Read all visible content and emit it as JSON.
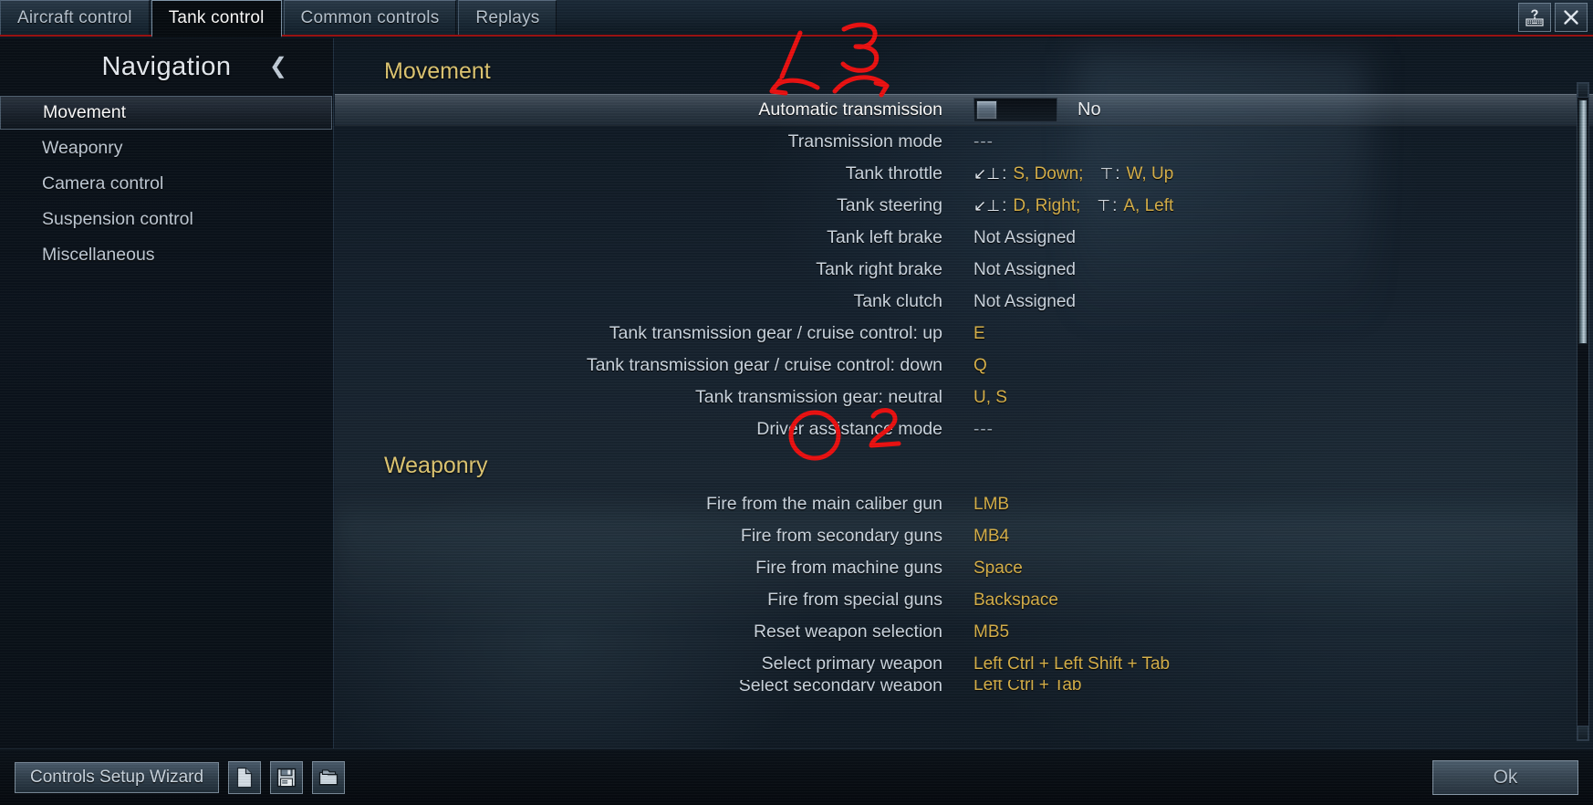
{
  "window": {
    "tabs": [
      {
        "label": "Aircraft control",
        "active": false
      },
      {
        "label": "Tank control",
        "active": true
      },
      {
        "label": "Common controls",
        "active": false
      },
      {
        "label": "Replays",
        "active": false
      }
    ],
    "help_icon": "keyboard-help-icon",
    "close_icon": "close-icon"
  },
  "sidebar": {
    "title": "Navigation",
    "collapse_icon": "chevron-left-icon",
    "items": [
      {
        "label": "Movement",
        "selected": true
      },
      {
        "label": "Weaponry",
        "selected": false
      },
      {
        "label": "Camera control",
        "selected": false
      },
      {
        "label": "Suspension control",
        "selected": false
      },
      {
        "label": "Miscellaneous",
        "selected": false
      }
    ]
  },
  "content": {
    "sections": [
      {
        "title": "Movement",
        "rows": [
          {
            "label": "Automatic transmission",
            "type": "toggle",
            "toggle_state": "off",
            "value": "No",
            "highlighted": true
          },
          {
            "label": "Transmission mode",
            "type": "text",
            "value": "---",
            "style": "dim"
          },
          {
            "label": "Tank throttle",
            "type": "axis",
            "axis_down_glyph": "axis-down-icon",
            "axis_down_value": "S, Down;",
            "axis_up_glyph": "axis-up-icon",
            "axis_up_value": "W, Up"
          },
          {
            "label": "Tank steering",
            "type": "axis",
            "axis_down_glyph": "axis-down-icon",
            "axis_down_value": "D, Right;",
            "axis_up_glyph": "axis-up-icon",
            "axis_up_value": "A, Left"
          },
          {
            "label": "Tank left brake",
            "type": "text",
            "value": "Not Assigned",
            "style": "plain"
          },
          {
            "label": "Tank right brake",
            "type": "text",
            "value": "Not Assigned",
            "style": "plain"
          },
          {
            "label": "Tank clutch",
            "type": "text",
            "value": "Not Assigned",
            "style": "plain"
          },
          {
            "label": "Tank transmission gear / cruise control: up",
            "type": "text",
            "value": "E"
          },
          {
            "label": "Tank transmission gear / cruise control: down",
            "type": "text",
            "value": "Q"
          },
          {
            "label": "Tank transmission gear: neutral",
            "type": "text",
            "value": "U, S"
          },
          {
            "label": "Driver assistance mode",
            "type": "text",
            "value": "---",
            "style": "dim"
          }
        ]
      },
      {
        "title": "Weaponry",
        "rows": [
          {
            "label": "Fire from the main caliber gun",
            "type": "text",
            "value": "LMB"
          },
          {
            "label": "Fire from secondary guns",
            "type": "text",
            "value": "MB4"
          },
          {
            "label": "Fire from machine guns",
            "type": "text",
            "value": "Space"
          },
          {
            "label": "Fire from special guns",
            "type": "text",
            "value": "Backspace"
          },
          {
            "label": "Reset weapon selection",
            "type": "text",
            "value": "MB5"
          },
          {
            "label": "Select primary weapon",
            "type": "text",
            "value": "Left Ctrl + Left Shift + Tab"
          },
          {
            "label": "Select secondary weapon",
            "type": "text",
            "value": "Left Ctrl + Tab",
            "clipped": true
          }
        ]
      }
    ]
  },
  "footer": {
    "wizard_label": "Controls Setup Wizard",
    "new_icon": "new-document-icon",
    "save_icon": "save-floppy-icon",
    "open_icon": "open-folder-icon",
    "ok_label": "Ok"
  },
  "annotations": [
    {
      "name": "annotation-1",
      "text": "1"
    },
    {
      "name": "annotation-2",
      "text": "2"
    },
    {
      "name": "annotation-3",
      "text": "3"
    }
  ],
  "colors": {
    "accent_gold": "#d9b24a",
    "section_heading": "#e0c873",
    "annotation_red": "#ee1111",
    "tab_underline": "#9c1010",
    "text_primary": "#ced8e2"
  }
}
